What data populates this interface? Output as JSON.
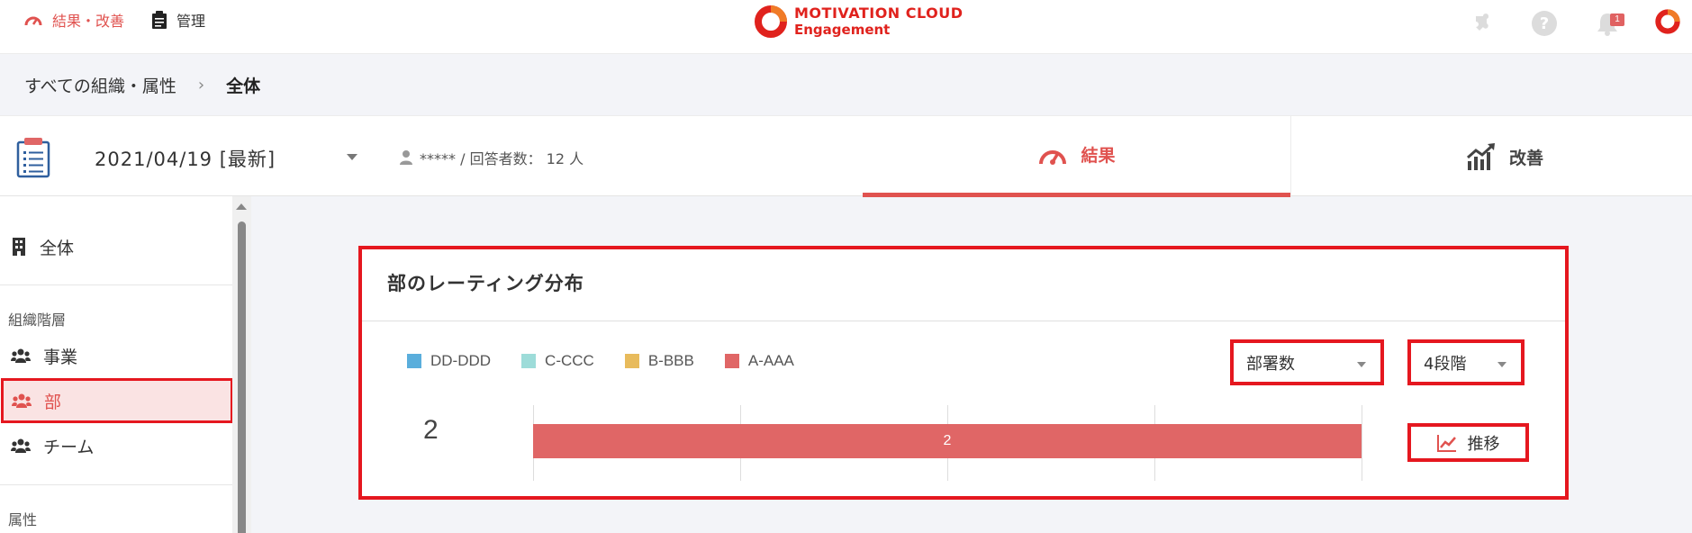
{
  "header": {
    "nav_results": "結果・改善",
    "nav_admin": "管理",
    "logo_line1": "MOTIVATION CLOUD",
    "logo_line2": "Engagement",
    "notification_count": "1",
    "icons": [
      "puzzle-icon",
      "help-icon",
      "bell-icon",
      "user-profile-icon"
    ]
  },
  "breadcrumb": {
    "root": "すべての組織・属性",
    "separator": "›",
    "current": "全体"
  },
  "survey": {
    "date": "2021/04/19 [最新]",
    "respondent": "***** / 回答者数： 12 人"
  },
  "tabs": {
    "results": "結果",
    "improve": "改善"
  },
  "sidebar": {
    "all": "全体",
    "org_heading": "組織階層",
    "items": [
      "事業",
      "部",
      "チーム"
    ],
    "active_item": "部",
    "attr_heading": "属性"
  },
  "card": {
    "title": "部のレーティング分布",
    "legend": [
      {
        "label": "DD-DDD",
        "color": "#5aaedc"
      },
      {
        "label": "C-CCC",
        "color": "#9ddcd9"
      },
      {
        "label": "B-BBB",
        "color": "#e8bb5c"
      },
      {
        "label": "A-AAA",
        "color": "#e06666"
      }
    ],
    "select_count": "部署数",
    "select_levels": "4段階",
    "row_label": "2",
    "bar_value": "2",
    "bar_fraction": 1.0,
    "trend_button": "推移"
  },
  "colors": {
    "accent": "#e0524f",
    "highlight_border": "#e5171f"
  }
}
